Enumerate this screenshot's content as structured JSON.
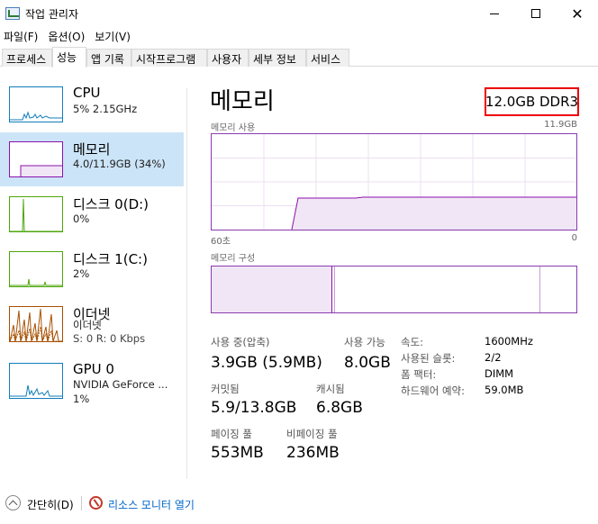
{
  "window": {
    "title": "작업 관리자",
    "close_glyph": "✕"
  },
  "menu": [
    "파일(F)",
    "옵션(O)",
    "보기(V)"
  ],
  "tabs": [
    "프로세스",
    "성능",
    "앱 기록",
    "시작프로그램",
    "사용자",
    "세부 정보",
    "서비스"
  ],
  "active_tab": "성능",
  "sidebar": {
    "items": [
      {
        "title": "CPU",
        "line1": "5% 2.15GHz",
        "line2": "",
        "color": "#117dbb"
      },
      {
        "title": "메모리",
        "line1": "4.0/11.9GB (34%)",
        "line2": "",
        "color": "#8b12ae"
      },
      {
        "title": "디스크 0(D:)",
        "line1": "0%",
        "line2": "",
        "color": "#4da60c"
      },
      {
        "title": "디스크 1(C:)",
        "line1": "2%",
        "line2": "",
        "color": "#4da60c"
      },
      {
        "title": "이더넷",
        "line1": "이더넷",
        "line2": "S: 0 R: 0 Kbps",
        "color": "#a74f01"
      },
      {
        "title": "GPU 0",
        "line1": "NVIDIA GeForce ...",
        "line2": "1%",
        "color": "#117dbb"
      }
    ]
  },
  "main": {
    "title": "메모리",
    "spec": "12.0GB DDR3",
    "usage_label": "메모리 사용",
    "usage_max": "11.9GB",
    "time_left": "60초",
    "time_right": "0",
    "composition_label": "메모리 구성",
    "usage_fraction": 0.34,
    "composition_in_use_fraction": 0.34
  },
  "stats": {
    "in_use_label": "사용 중(압축)",
    "in_use_value": "3.9GB (5.9MB)",
    "available_label": "사용 가능",
    "available_value": "8.0GB",
    "committed_label": "커밋됨",
    "committed_value": "5.9/13.8GB",
    "cached_label": "캐시됨",
    "cached_value": "6.8GB",
    "paged_label": "페이징 풀",
    "paged_value": "553MB",
    "nonpaged_label": "비페이징 풀",
    "nonpaged_value": "236MB"
  },
  "specs": [
    {
      "label": "속도:",
      "value": "1600MHz"
    },
    {
      "label": "사용된 슬롯:",
      "value": "2/2"
    },
    {
      "label": "폼 팩터:",
      "value": "DIMM"
    },
    {
      "label": "하드웨어 예약:",
      "value": "59.0MB"
    }
  ],
  "footer": {
    "fewer_details": "간단히(D)",
    "resource_monitor": "리소스 모니터 열기"
  }
}
